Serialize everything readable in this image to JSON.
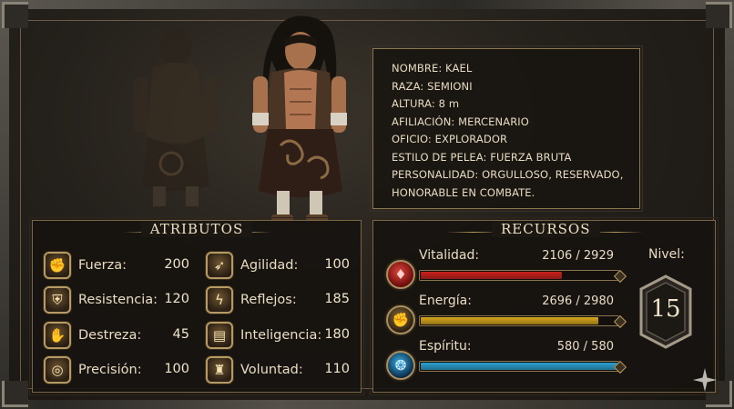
{
  "character": {
    "info": [
      "NOMBRE: KAEL",
      "RAZA: SEMIONI",
      "ALTURA: 8 m",
      "AFILIACIÓN: MERCENARIO",
      "OFICIO: EXPLORADOR",
      "ESTILO DE PELEA: FUERZA BRUTA",
      "PERSONALIDAD: ORGULLOSO, RESERVADO,",
      "HONORABLE EN COMBATE."
    ]
  },
  "attributes": {
    "title": "ATRIBUTOS",
    "left": [
      {
        "label": "Fuerza:",
        "value": "200",
        "icon": "fist-icon"
      },
      {
        "label": "Resistencia:",
        "value": "120",
        "icon": "shield-icon"
      },
      {
        "label": "Destreza:",
        "value": "45",
        "icon": "hand-icon"
      },
      {
        "label": "Precisión:",
        "value": "100",
        "icon": "target-icon"
      }
    ],
    "right": [
      {
        "label": "Agilidad:",
        "value": "100",
        "icon": "wing-foot-icon"
      },
      {
        "label": "Reflejos:",
        "value": "185",
        "icon": "lightning-icon"
      },
      {
        "label": "Inteligencia:",
        "value": "180",
        "icon": "book-icon"
      },
      {
        "label": "Voluntad:",
        "value": "110",
        "icon": "helmet-icon"
      }
    ]
  },
  "resources": {
    "title": "RECURSOS",
    "items": [
      {
        "label": "Vitalidad:",
        "value": "2106 / 2929",
        "current": 2106,
        "max": 2929,
        "color": "#c8201c",
        "icon": "blood-drop-icon"
      },
      {
        "label": "Energía:",
        "value": "2696 / 2980",
        "current": 2696,
        "max": 2980,
        "color": "#d6a61c",
        "icon": "flexed-arm-icon"
      },
      {
        "label": "Espíritu:",
        "value": "580 / 580",
        "current": 580,
        "max": 580,
        "color": "#2a9fd0",
        "icon": "spirit-swirl-icon"
      }
    ],
    "level_label": "Nivel:",
    "level": "15"
  }
}
